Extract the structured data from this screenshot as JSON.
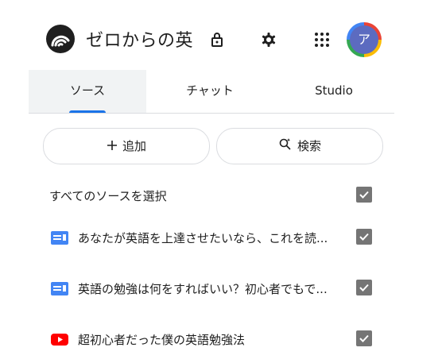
{
  "header": {
    "title": "ゼロからの英",
    "avatar_initial": "ア",
    "icons": [
      "notebook-logo-icon",
      "lock-icon",
      "gear-icon",
      "apps-grid-icon"
    ]
  },
  "tabs": [
    {
      "label": "ソース",
      "selected": true
    },
    {
      "label": "チャット",
      "selected": false
    },
    {
      "label": "Studio",
      "selected": false
    }
  ],
  "actions": {
    "add_label": "追加",
    "search_label": "検索"
  },
  "sources": {
    "select_all_label": "すべてのソースを選択",
    "select_all_checked": true,
    "items": [
      {
        "title": "あなたが英語を上達させたいなら、これを読...",
        "type": "document",
        "checked": true
      },
      {
        "title": "英語の勉強は何をすればいい？初心者でもで...",
        "type": "document",
        "checked": true
      },
      {
        "title": "超初心者だった僕の英語勉強法",
        "type": "youtube",
        "checked": true
      }
    ]
  },
  "colors": {
    "accent": "#1a73e8",
    "doc_icon": "#4285f4",
    "youtube_icon": "#ff0000",
    "checkbox": "#757575",
    "tab_selected_bg": "#f1f3f4"
  }
}
